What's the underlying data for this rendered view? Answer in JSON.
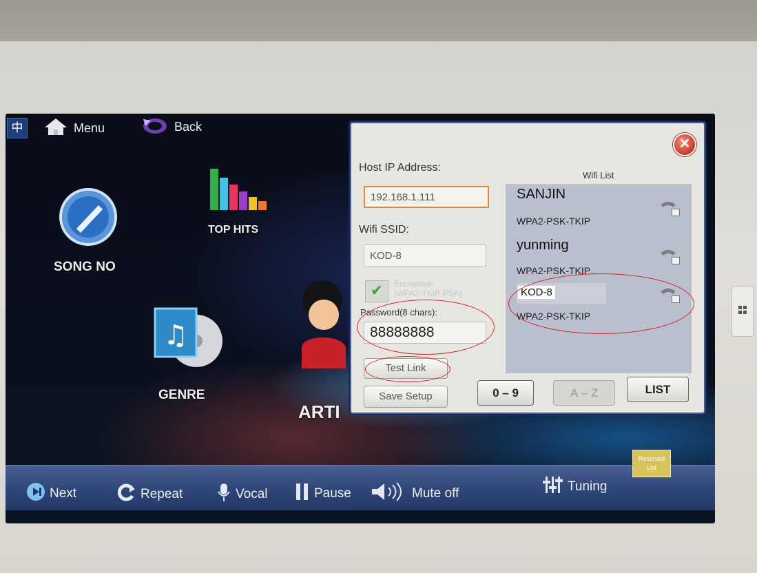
{
  "top_bar": {
    "lang_label": "中",
    "menu_label": "Menu",
    "back_label": "Back"
  },
  "tiles": {
    "song_no": "SONG NO",
    "top_hits": "TOP HITS",
    "genre": "GENRE",
    "artist": "ARTI"
  },
  "dialog": {
    "host_ip_label": "Host IP Address:",
    "host_ip_value": "192.168.1.111",
    "wifi_ssid_label": "Wifi SSID:",
    "wifi_ssid_value": "KOD-8",
    "encryption_label": "Encryption",
    "encryption_type": "[WPA2-TKIP-PSK]",
    "password_label": "Password(8 chars):",
    "password_value": "88888888",
    "test_link_label": "Test Link",
    "save_setup_label": "Save Setup",
    "wifi_list_title": "Wifi List",
    "wifi_list": [
      {
        "name": "SANJIN",
        "encryption": "WPA2-PSK-TKIP"
      },
      {
        "name": "yunming",
        "encryption": "WPA2-PSK-TKIP"
      },
      {
        "name": "KOD-8",
        "encryption": "WPA2-PSK-TKIP"
      }
    ],
    "keys": {
      "digits": "0 – 9",
      "letters": "A – Z",
      "list": "LIST"
    }
  },
  "bottom_bar": {
    "next": "Next",
    "repeat": "Repeat",
    "vocal": "Vocal",
    "pause": "Pause",
    "mute": "Mute off",
    "tuning": "Tuning",
    "reserved": "Reserved",
    "reserved_list": "List"
  },
  "colors": {
    "accent_blue": "#30477a",
    "annotation_red": "#d3232b",
    "wifi_panel": "#b9bfcc",
    "dialog_bg": "#e7e6e1"
  }
}
